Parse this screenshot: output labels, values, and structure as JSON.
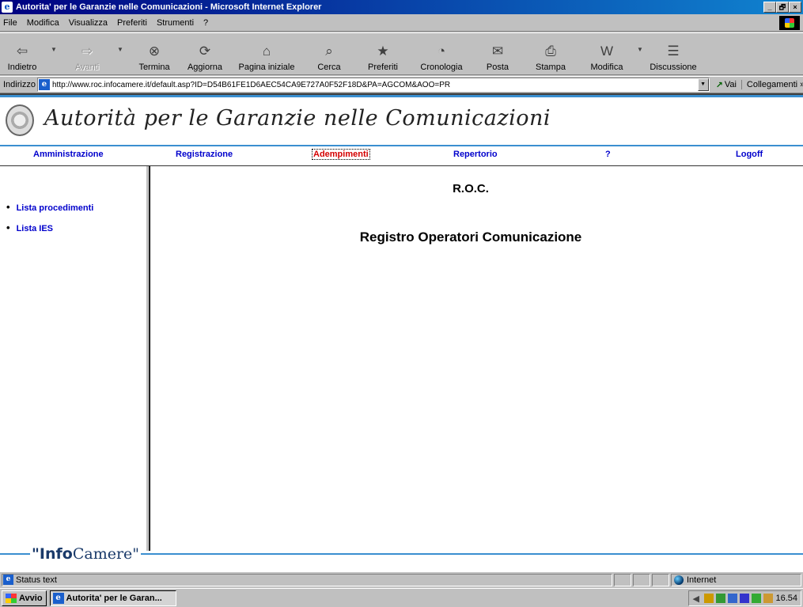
{
  "window": {
    "title": "Autorita' per le Garanzie nelle Comunicazioni - Microsoft Internet Explorer",
    "minimize": "_",
    "maximize": "🗗",
    "close": "×"
  },
  "menu": [
    "File",
    "Modifica",
    "Visualizza",
    "Preferiti",
    "Strumenti",
    "?"
  ],
  "toolbar": {
    "back": "Indietro",
    "forward": "Avanti",
    "stop": "Termina",
    "refresh": "Aggiorna",
    "home": "Pagina iniziale",
    "search": "Cerca",
    "favorites": "Preferiti",
    "history": "Cronologia",
    "mail": "Posta",
    "print": "Stampa",
    "edit": "Modifica",
    "discuss": "Discussione"
  },
  "address": {
    "label": "Indirizzo",
    "url": "http://www.roc.infocamere.it/default.asp?ID=D54B61FE1D6AEC54CA9E727A0F52F18D&PA=AGCOM&AOO=PR",
    "go": "Vai",
    "links": "Collegamenti »"
  },
  "page": {
    "agency": "Autorità per le Garanzie nelle Comunicazioni",
    "nav": {
      "admin": "Amministrazione",
      "registration": "Registrazione",
      "obligations": "Adempimenti",
      "repertory": "Repertorio",
      "help": "?",
      "logoff": "Logoff"
    },
    "sidebar": [
      "Lista procedimenti",
      "Lista IES"
    ],
    "heading": "R.O.C.",
    "subheading": "Registro Operatori Comunicazione",
    "footer_logo_bold": "\"Info",
    "footer_logo_rest": "Camere\""
  },
  "status": {
    "text": "Status text",
    "zone": "Internet"
  },
  "taskbar": {
    "start": "Avvio",
    "task": "Autorita' per le Garan...",
    "clock": "16.54"
  }
}
